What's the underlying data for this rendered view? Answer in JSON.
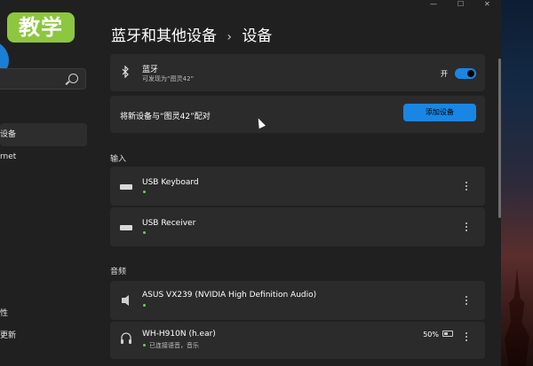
{
  "overlay_badge": "教学",
  "window": {
    "min": "—",
    "max": "☐",
    "close": "✕"
  },
  "sidebar": {
    "items": [
      {
        "label": "设备"
      },
      {
        "label": "rnet"
      },
      {
        "label": "性"
      },
      {
        "label": "更新"
      }
    ]
  },
  "header": {
    "title": "蓝牙和其他设备",
    "sep": "›",
    "current": "设备"
  },
  "bluetooth_card": {
    "title": "蓝牙",
    "subtitle": "可发现为“图灵42”",
    "toggle_label": "开",
    "toggle_on": true
  },
  "pair_card": {
    "text": "将新设备与“图灵42”配对",
    "button": "添加设备"
  },
  "sections": {
    "input": "输入",
    "audio": "音频"
  },
  "input_devices": [
    {
      "name": "USB Keyboard"
    },
    {
      "name": "USB Receiver"
    }
  ],
  "audio_devices": [
    {
      "name": "ASUS VX239 (NVIDIA High Definition Audio)",
      "status": ""
    },
    {
      "name": "WH-H910N (h.ear)",
      "status": "已连接语音，音乐",
      "battery": "50%"
    }
  ],
  "colors": {
    "accent": "#1a86e3",
    "badge": "#8dc63f",
    "connected": "#6ccb5f"
  }
}
